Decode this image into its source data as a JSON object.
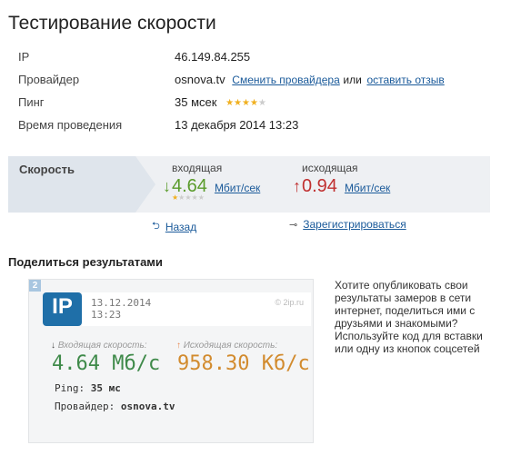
{
  "page_title": "Тестирование скорости",
  "info": {
    "ip_label": "IP",
    "ip_value": "46.149.84.255",
    "provider_label": "Провайдер",
    "provider_value": "osnova.tv",
    "change_provider_link": "Сменить провайдера",
    "or_text": "или",
    "review_link": "оставить отзыв",
    "ping_label": "Пинг",
    "ping_value": "35 мсек",
    "ping_stars": 4,
    "time_label": "Время проведения",
    "time_value": "13 декабря 2014 13:23"
  },
  "speed": {
    "label": "Скорость",
    "in_caption": "входящая",
    "in_value": "4.64",
    "in_unit": "Мбит/сек",
    "in_stars": 1,
    "out_caption": "исходящая",
    "out_value": "0.94",
    "out_unit": "Мбит/сек"
  },
  "links": {
    "back": "Назад",
    "register": "Зарегистрироваться"
  },
  "share": {
    "title": "Поделиться результатами",
    "text": "Хотите опубликовать свои результаты замеров в сети интернет, поделиться ими с друзьями и знакомыми? Используйте код для вставки или одну из кнопок соцсетей"
  },
  "card": {
    "number": "2",
    "logo": "IP",
    "date": "13.12.2014",
    "time": "13:23",
    "brand": "© 2ip.ru",
    "in_label": "Входящая скорость:",
    "in_value": "4.64 Мб/с",
    "out_label": "Исходящая скорость:",
    "out_value": "958.30 Кб/с",
    "ping_label": "Ping:",
    "ping_value": "35 мс",
    "provider_label": "Провайдер:",
    "provider_value": "osnova.tv"
  },
  "colors": {
    "incoming": "#5a9b2b",
    "outgoing": "#c03030",
    "link": "#1a5a9a"
  }
}
